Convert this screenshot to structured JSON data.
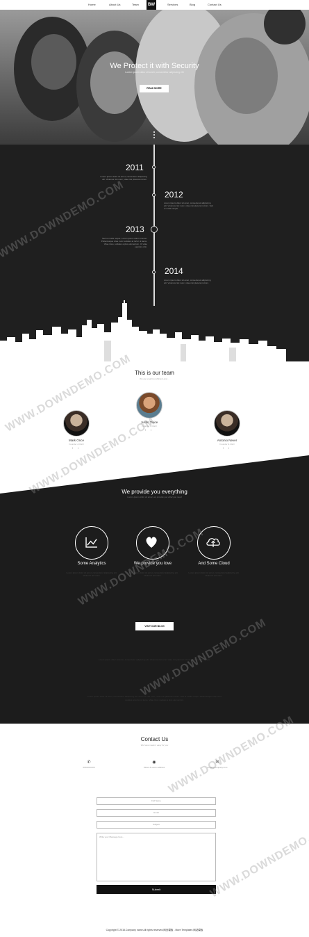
{
  "nav": {
    "items": [
      "Home",
      "About Us",
      "Team",
      "Services",
      "Blog",
      "Contact Us"
    ],
    "logo": "BW"
  },
  "hero": {
    "title": "We Protect it with Security",
    "subtitle": "Lorem ipsum dolor sit amet, consectetur adipiscing elit",
    "button": "READ MORE"
  },
  "timeline": [
    {
      "year": "2011",
      "text": "Lorem ipsum dolor sit amet, consectetur adipiscing elit. Vivamus nisi nunc, vitae nisi placerat rutrum."
    },
    {
      "year": "2012",
      "text": "Lorem ipsum dolor sit amet, consectetur adipiscing elit. Vivamus nisi nunc, vitae nisi placerat rutrum. Sed ut mollis neque."
    },
    {
      "year": "2013",
      "text": "Sed ut mollis neque. Lorem ipsum dolor sit amet. Pellentesque vitae nunc sodales at tortor ut lacus. Vitae risus, sodales a plus elementum. Ut vitae egestas odio."
    },
    {
      "year": "2014",
      "text": "Lorem ipsum dolor sit amet, consectetur adipiscing elit. Vivamus nisi nunc, vitae nisi placerat rutrum."
    }
  ],
  "team": {
    "title": "This is our team",
    "subtitle": "We are small but efficient and ...",
    "members": [
      {
        "name": "Mark Once",
        "role": "Founder & CEO",
        "socials": "f t"
      },
      {
        "name": "Justin Twice",
        "role": "Founder & CEO",
        "socials": "f t"
      },
      {
        "name": "Antonio Never",
        "role": "Founder & CEO",
        "socials": "f t"
      }
    ]
  },
  "services": {
    "title": "We provide you everything",
    "subtitle": "Lorem ipsum dolor sit amet, we provide you what you need",
    "items": [
      {
        "label": "Some Analytics",
        "icon": "chart-icon",
        "desc": "Lorem ipsum dolor sit amet, consectetur adipiscing elit. Vivamus nisi nunc."
      },
      {
        "label": "We provide you love",
        "icon": "heart-icon",
        "desc": "Lorem ipsum dolor sit amet, consectetur adipiscing elit. Vivamus nisi nunc."
      },
      {
        "label": "And Some Cloud",
        "icon": "cloud-upload-icon",
        "desc": "Lorem ipsum dolor sit amet, consectetur adipiscing elit. Vivamus nisi nunc."
      }
    ],
    "blog_button": "VISIT OUR BLOG",
    "paragraph_1": "Lorem ipsum dolor sit amet, consectetur adipiscing elit. Vivamus nisi nunc, vitae nisi placerat rutrum. Sed ut mollis neque.",
    "paragraph_2": "Lorem ipsum dolor sit amet, consectetur adipiscing elit. Vivamus nisi nunc, vitae nisi placerat rutrum. Sed ut mollis neque. Pellentesque vitae nunc sodales at tortor ut lacus. Vitae risus sodales a plus elementum."
  },
  "contact": {
    "title": "Contact Us",
    "subtitle": "We have made it easy for you",
    "items": [
      {
        "icon": "phone-icon",
        "text": "000-000-000"
      },
      {
        "icon": "location-icon",
        "text": "Street & some address"
      },
      {
        "icon": "mail-icon",
        "text": "email@company.com"
      }
    ],
    "fields": {
      "full_name": "Full Name",
      "email": "Email",
      "subject": "Subject",
      "message": "Write your Message here..."
    },
    "submit": "Submit"
  },
  "footer": {
    "copyright": "Copyright © 2015.Company name All rights reserved.网页模板 - More Templates 网站模板"
  },
  "watermark": "WWW.DOWNDEMO.COM",
  "colors": {
    "dark": "#1f1f1f",
    "accent": "#ffffff",
    "text": "#222222"
  }
}
